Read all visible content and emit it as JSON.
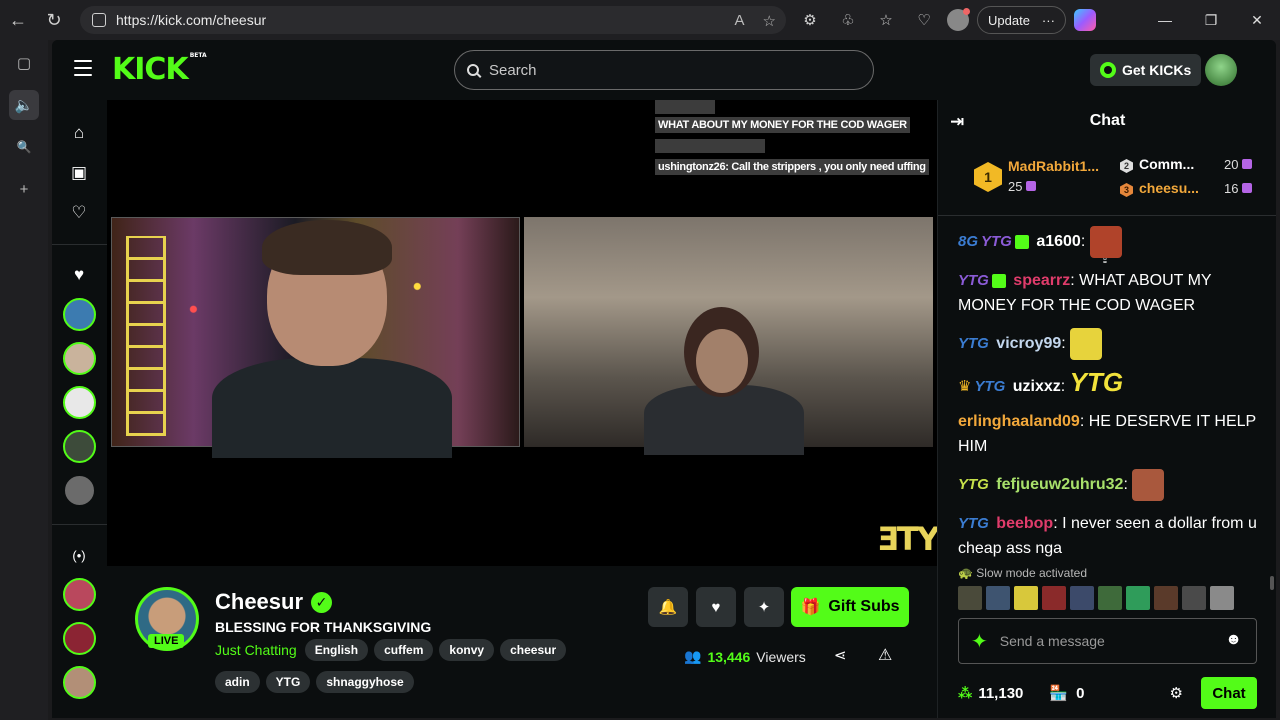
{
  "browser": {
    "url": "https://kick.com/cheesur",
    "update_label": "Update",
    "more_label": "···"
  },
  "header": {
    "logo_text": "KICK",
    "logo_beta": "BETA",
    "search_placeholder": "Search",
    "get_kicks_label": "Get KICKs"
  },
  "video_overlay": {
    "lines": [
      {
        "text": "WHAT ABOUT MY MONEY FOR THE COD WAGER"
      },
      {
        "text": "ushingtonz26:  Call the strippers , you only need uffing"
      }
    ],
    "watermark": "ƎTY"
  },
  "stream": {
    "streamer": "Cheesur",
    "live_label": "LIVE",
    "title": "BLESSING FOR THANKSGIVING",
    "category": "Just Chatting",
    "tags": [
      "English",
      "cuffem",
      "konvy",
      "cheesur",
      "adin",
      "YTG",
      "shnaggyhose"
    ],
    "gift_label": "Gift Subs",
    "viewer_count": "13,446",
    "viewers_label": "Viewers"
  },
  "chat": {
    "title": "Chat",
    "leaderboard": {
      "first": {
        "rank": "1",
        "name": "MadRabbit1...",
        "value": "25"
      },
      "second": {
        "rank": "2",
        "name": "Comm...",
        "value": "20"
      },
      "third": {
        "rank": "3",
        "name": "cheesu...",
        "value": "16"
      }
    },
    "messages": [
      {
        "user": "a1600",
        "user_color": "#e6e6e6",
        "text": ""
      },
      {
        "user": "spearrz",
        "user_color": "#e03c6b",
        "text": "WHAT ABOUT MY MONEY FOR THE COD WAGER"
      },
      {
        "user": "vicroy99",
        "user_color": "#c3d7ee",
        "text": ""
      },
      {
        "user": "uzixxz",
        "user_color": "#e6e6e6",
        "text": ""
      },
      {
        "user": "erlinghaaland09",
        "user_color": "#f2a83b",
        "text": "HE DESERVE IT HELP HIM"
      },
      {
        "user": "fefjueuw2uhru32",
        "user_color": "#a8e06b",
        "text": ""
      },
      {
        "user": "beebop",
        "user_color": "#e03c6b",
        "text": "I never seen a dollar from u cheap ass nga"
      }
    ],
    "badge_text": "YTG",
    "slow_mode": "Slow mode activated",
    "input_placeholder": "Send a message",
    "points": "11,130",
    "store_count": "0",
    "send_label": "Chat"
  },
  "colors": {
    "accent": "#53fc18",
    "background": "#0b0e0f"
  }
}
